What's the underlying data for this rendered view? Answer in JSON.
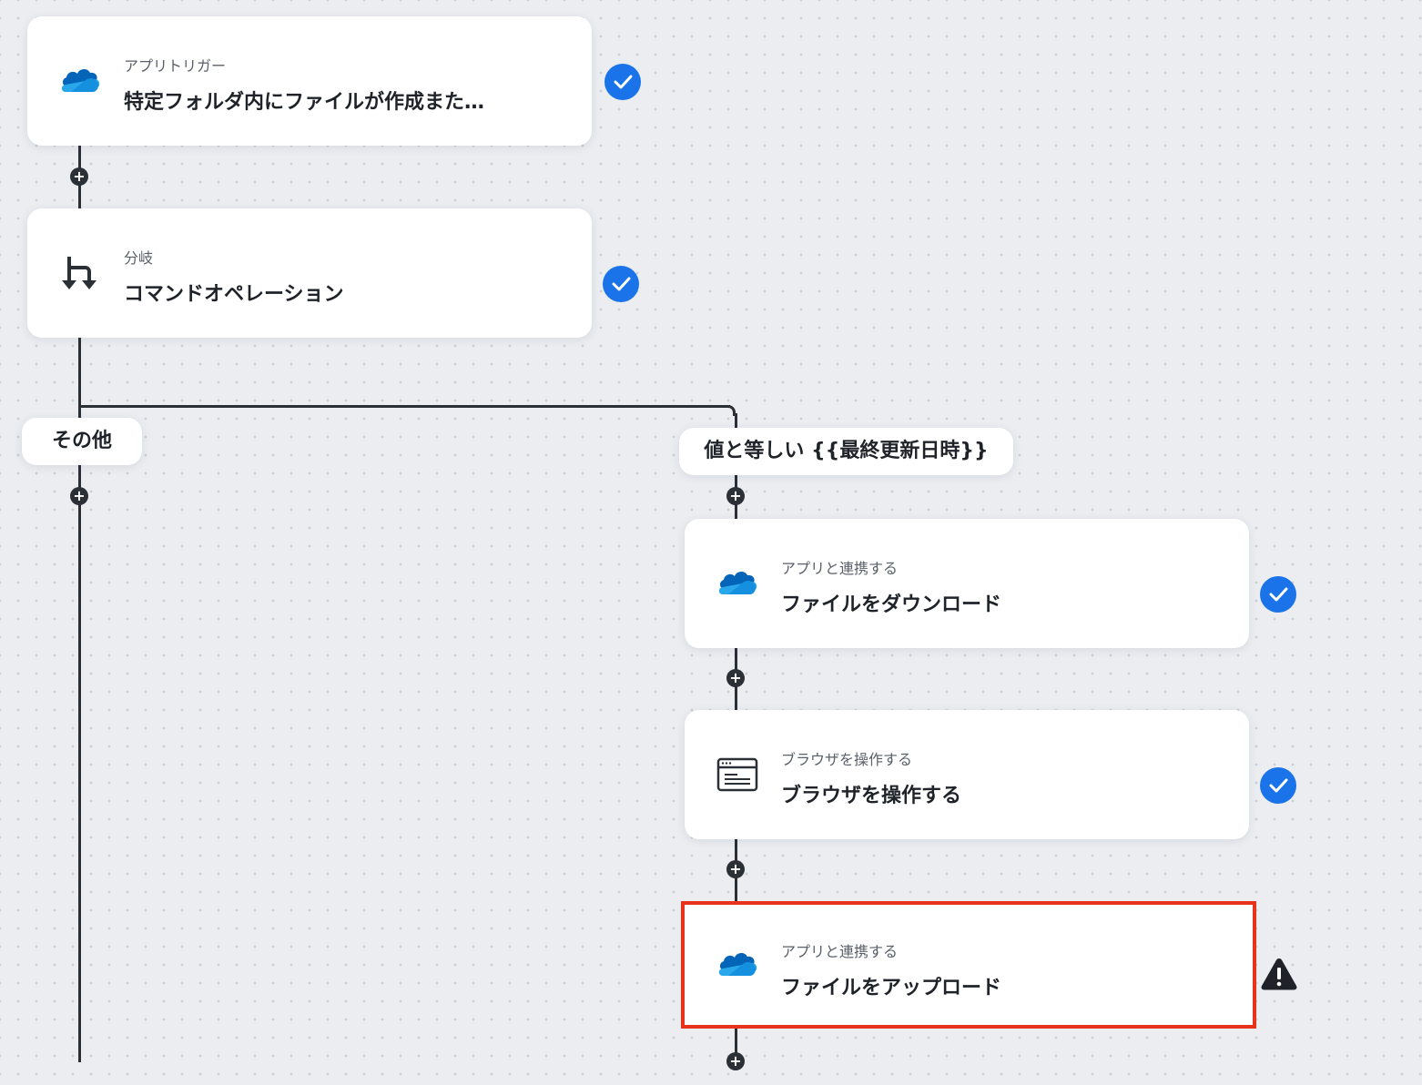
{
  "trigger": {
    "subtitle": "アプリトリガー",
    "title": "特定フォルダ内にファイルが作成また…"
  },
  "branch": {
    "subtitle": "分岐",
    "title": "コマンドオペレーション"
  },
  "branch_labels": {
    "other": "その他",
    "equals": "値と等しい {{最終更新日時}}"
  },
  "download": {
    "subtitle": "アプリと連携する",
    "title": "ファイルをダウンロード"
  },
  "browser": {
    "subtitle": "ブラウザを操作する",
    "title": "ブラウザを操作する"
  },
  "upload": {
    "subtitle": "アプリと連携する",
    "title": "ファイルをアップロード"
  },
  "colors": {
    "check": "#1a73e8",
    "selected_border": "#e8321b",
    "line": "#2b2f36"
  },
  "icons": [
    "onedrive-icon",
    "branch-icon",
    "browser-window-icon",
    "check-icon",
    "warning-icon",
    "plus-icon"
  ]
}
